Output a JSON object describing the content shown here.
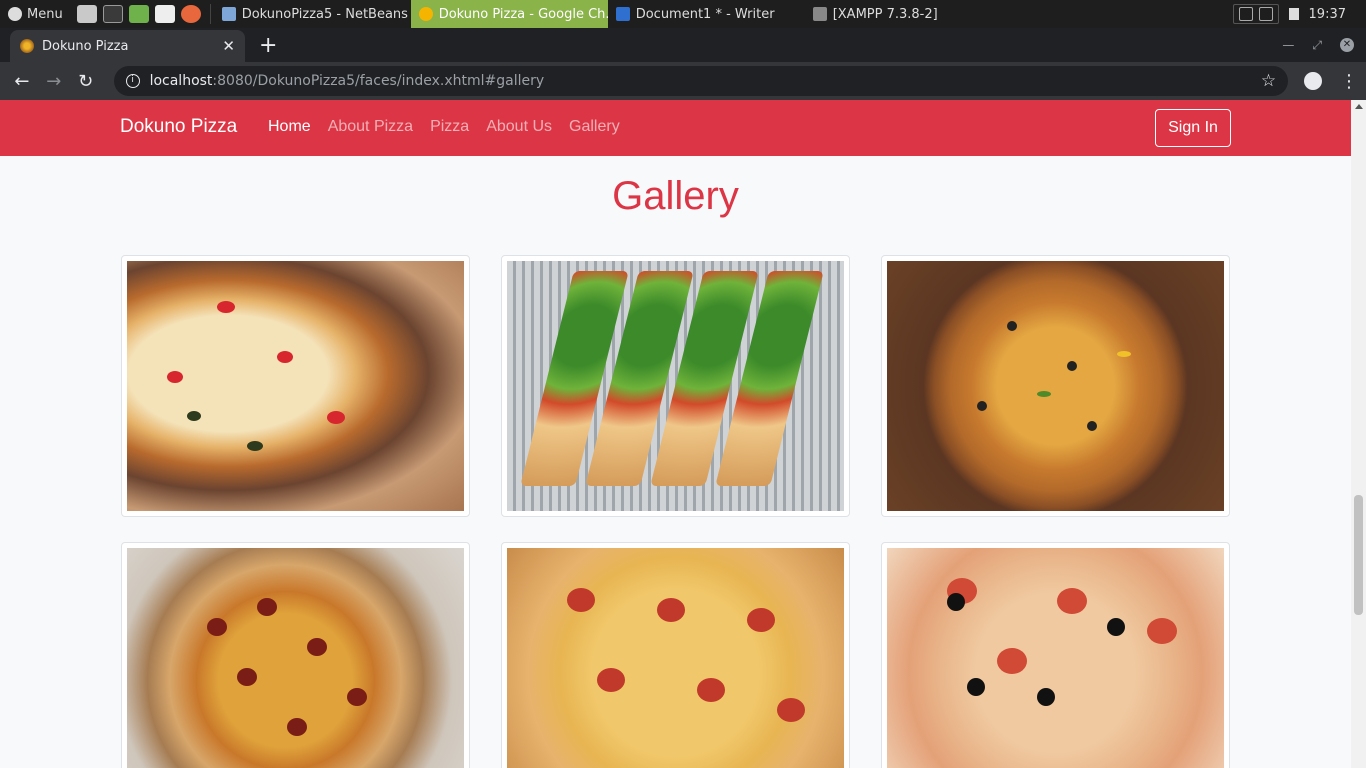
{
  "taskbar": {
    "menu_label": "Menu",
    "tasks": [
      {
        "label": "DokunoPizza5 - NetBeans ...",
        "color": "#7ea7d8"
      },
      {
        "label": "Dokuno Pizza - Google Ch...",
        "color": "#f4b400"
      },
      {
        "label": "Document1 * - Writer",
        "color": "#2f6fd0"
      },
      {
        "label": "[XAMPP 7.3.8-2]",
        "color": "#888888"
      }
    ],
    "clock": "19:37"
  },
  "browser": {
    "tab_title": "Dokuno Pizza",
    "url_host": "localhost",
    "url_rest": ":8080/DokunoPizza5/faces/index.xhtml#gallery"
  },
  "site": {
    "brand": "Dokuno Pizza",
    "nav": [
      "Home",
      "About Pizza",
      "Pizza",
      "About Us",
      "Gallery"
    ],
    "active_nav": "Home",
    "signin_label": "Sign In",
    "accent_color": "#dc3545",
    "gallery_title": "Gallery",
    "gallery_images": [
      "cheese-pull-pizza-slice",
      "arugula-tomato-flatbread-slices",
      "vegetable-olive-pizza",
      "pepperoni-pizza-on-board",
      "pepperoni-pizza-in-box",
      "pepperoni-olive-pizza"
    ]
  }
}
